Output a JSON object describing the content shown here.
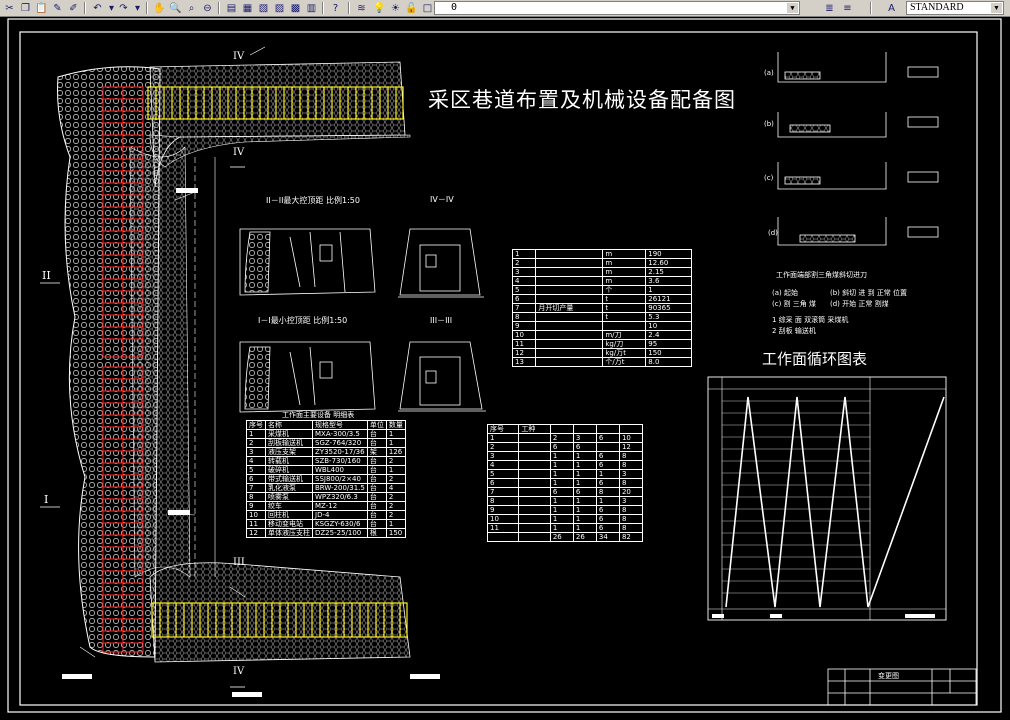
{
  "toolbar": {
    "layer_value": "0",
    "text_style": "STANDARD"
  },
  "drawing": {
    "title": "采区巷道布置及机械设备配备图",
    "cycle_title": "工作面循环图表",
    "section_labels": {
      "s1": "II",
      "s2": "I",
      "s3": "III",
      "s4": "IV",
      "top_mark": "IV",
      "mid_mark": "IV",
      "bottom_mark": "III",
      "base_mark": "IV"
    },
    "section_views": {
      "max_title": "II－II最大控顶距   比例1:50",
      "min_title": "I－I最小控顶距   比例1:50",
      "iv_iv": "IV－IV",
      "iii_iii": "III－III"
    },
    "equipment_table": {
      "title": "工作面主要设备 明细表",
      "headers": [
        "序号",
        "名称",
        "规格型号",
        "单位",
        "数量"
      ],
      "rows": [
        [
          "1",
          "采煤机",
          "MXA-300/3.5",
          "台",
          "1"
        ],
        [
          "2",
          "刮板输送机",
          "SGZ-764/320",
          "台",
          "1"
        ],
        [
          "3",
          "液压支架",
          "ZY3520-17/36",
          "架",
          "126"
        ],
        [
          "4",
          "转载机",
          "SZB-730/160",
          "台",
          "2"
        ],
        [
          "5",
          "破碎机",
          "WBL400",
          "台",
          "1"
        ],
        [
          "6",
          "带式输送机",
          "SSJ800/2×40",
          "台",
          "2"
        ],
        [
          "7",
          "乳化液泵",
          "BRW-200/31.5",
          "台",
          "4"
        ],
        [
          "8",
          "喷雾泵",
          "WPZ320/6.3",
          "台",
          "2"
        ],
        [
          "9",
          "绞车",
          "MZ-12",
          "台",
          "2"
        ],
        [
          "10",
          "回柱机",
          "JD-4",
          "台",
          "2"
        ],
        [
          "11",
          "移动变电站",
          "KSGZY-630/6",
          "台",
          "1"
        ],
        [
          "12",
          "单体液压支柱",
          "DZ25-25/100",
          "根",
          "150"
        ]
      ]
    },
    "tech_table": {
      "rows": [
        [
          "1",
          "",
          "m",
          "190"
        ],
        [
          "2",
          "",
          "m",
          "12.60"
        ],
        [
          "3",
          "",
          "m",
          "2.15"
        ],
        [
          "4",
          "",
          "m",
          "3.6"
        ],
        [
          "5",
          "",
          "个",
          "1"
        ],
        [
          "6",
          "",
          "t",
          "26121"
        ],
        [
          "7",
          "月开切产量",
          "t",
          "90365"
        ],
        [
          "8",
          "",
          "t",
          "5.3"
        ],
        [
          "9",
          "",
          "",
          "10"
        ],
        [
          "10",
          "",
          "m/刀",
          "2.4"
        ],
        [
          "11",
          "",
          "kg/刀",
          "95"
        ],
        [
          "12",
          "",
          "kg/万t",
          "150"
        ],
        [
          "13",
          "",
          "个/万t",
          "8.0"
        ]
      ]
    },
    "labor_table": {
      "headers": [
        "序号",
        "工种"
      ],
      "rows": [
        [
          "1",
          "",
          "2",
          "3",
          "6",
          "10"
        ],
        [
          "2",
          "",
          "6",
          "6",
          "",
          "12"
        ],
        [
          "3",
          "",
          "1",
          "1",
          "6",
          "8"
        ],
        [
          "4",
          "",
          "1",
          "1",
          "6",
          "8"
        ],
        [
          "5",
          "",
          "1",
          "1",
          "1",
          "3"
        ],
        [
          "6",
          "",
          "1",
          "1",
          "6",
          "8"
        ],
        [
          "7",
          "",
          "6",
          "6",
          "8",
          "20"
        ],
        [
          "8",
          "",
          "1",
          "1",
          "1",
          "3"
        ],
        [
          "9",
          "",
          "1",
          "1",
          "6",
          "8"
        ],
        [
          "10",
          "",
          "1",
          "1",
          "6",
          "8"
        ],
        [
          "11",
          "",
          "1",
          "1",
          "6",
          "8"
        ],
        [
          "",
          "",
          "26",
          "26",
          "34",
          "82"
        ]
      ]
    },
    "cutting_legend": {
      "caption": "工作面端部割三角煤斜切进刀",
      "items": [
        "(a) 起始",
        "(b) 斜切 进 到 正常 位置",
        "(c) 割 三角 煤",
        "(d) 开始 正常 割煤",
        "1  综采 面 双滚筒 采煤机",
        "2  刮板 输送机"
      ],
      "steps": [
        "(a)",
        "(b)",
        "(c)",
        "(d)"
      ]
    },
    "title_block": {
      "name": "变更图"
    }
  }
}
